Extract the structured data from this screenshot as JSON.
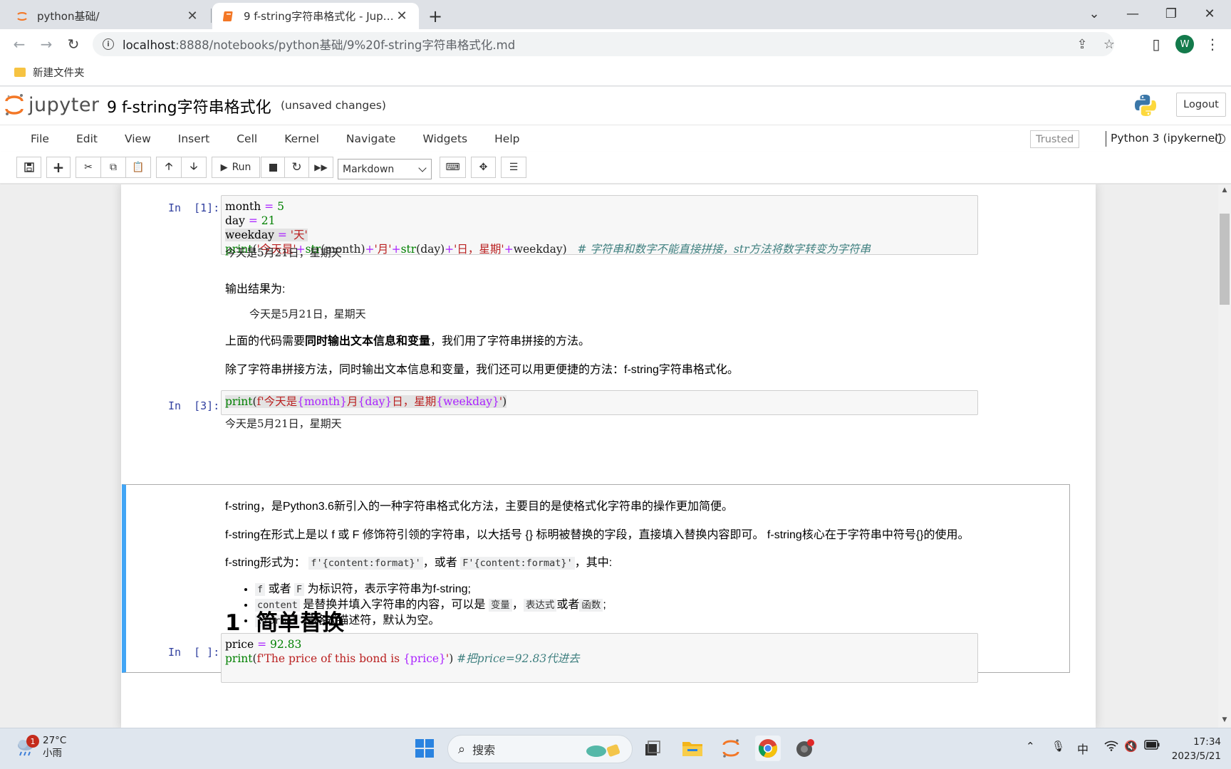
{
  "browser": {
    "tabs": [
      {
        "label": "python基础/",
        "active": false
      },
      {
        "label": "9 f-string字符串格式化 - Jupyter Notebook",
        "active": true
      }
    ],
    "url_host": "localhost",
    "url_rest": ":8888/notebooks/python基础/9%20f-string字符串格式化.md",
    "profile_initial": "W",
    "bookmark": "新建文件夹"
  },
  "jupyter": {
    "logo_text": "jupyter",
    "notebook_title": "9 f-string字符串格式化",
    "save_status": "(unsaved changes)",
    "logout": "Logout",
    "menus": [
      "File",
      "Edit",
      "View",
      "Insert",
      "Cell",
      "Kernel",
      "Navigate",
      "Widgets",
      "Help"
    ],
    "trusted": "Trusted",
    "kernel": "Python 3 (ipykernel)",
    "run_label": "Run",
    "cell_type": "Markdown"
  },
  "cells": {
    "c1": {
      "prompt": "In  [1]:",
      "line1_var": "month",
      "line1_op": " = ",
      "line1_val": "5",
      "line2_var": "day",
      "line2_op": " = ",
      "line2_val": "21",
      "line3_var": "weekday",
      "line3_op": " = ",
      "line3_val": "'天'",
      "line4_fn": "print",
      "line4_p1": "(",
      "line4_s1": "'今天是'",
      "line4_o1": "+",
      "line4_f1": "str",
      "line4_a1": "(month)",
      "line4_o2": "+",
      "line4_s2": "'月'",
      "line4_o3": "+",
      "line4_f2": "str",
      "line4_a2": "(day)",
      "line4_o4": "+",
      "line4_s3": "'日，星期'",
      "line4_o5": "+",
      "line4_a3": "weekday)",
      "line4_comment": "# 字符串和数字不能直接拼接，str方法将数字转变为字符串",
      "output": "今天是5月21日，星期天"
    },
    "md1": {
      "p1": "输出结果为:",
      "p2": "今天是5月21日，星期天",
      "p3_a": "上面的代码需要",
      "p3_b": "同时输出文本信息和变量",
      "p3_c": "，我们用了字符串拼接的方法。",
      "p4": "除了字符串拼接方法，同时输出文本信息和变量，我们还可以用更便捷的方法：f-string字符串格式化。"
    },
    "c3": {
      "prompt": "In  [3]:",
      "fn": "print",
      "p": "(",
      "s1": "f'今天是",
      "v1": "{month}",
      "s2": "月",
      "v2": "{day}",
      "s3": "日，星期",
      "v3": "{weekday}",
      "s4": "'",
      "p2": ")",
      "output": "今天是5月21日，星期天"
    },
    "md2": {
      "p1": "f-string，是Python3.6新引入的一种字符串格式化方法，主要目的是使格式化字符串的操作更加简便。",
      "p2": "f-string在形式上是以 f 或 F 修饰符引领的字符串，以大括号 {} 标明被替换的字段，直接填入替换内容即可。 f-string核心在于字符串中符号{}的使用。",
      "p3_a": "f-string形式为：",
      "p3_code1": "f'{content:format}'",
      "p3_b": "，或者",
      "p3_code2": "F'{content:format}'",
      "p3_c": "，其中:",
      "li1_code1": "f",
      "li1_a": " 或者 ",
      "li1_code2": "F",
      "li1_b": " 为标识符，表示字符串为f-string;",
      "li2_code1": "content",
      "li2_a": " 是替换并填入字符串的内容，可以是 ",
      "li2_code2": "变量",
      "li2_b": "，",
      "li2_code3": "表达式",
      "li2_c": "或者",
      "li2_code4": "函数",
      "li2_d": ";",
      "li3_code1": ":format",
      "li3_a": " 是格式描述符，默认为空。",
      "heading": "1  简单替换"
    },
    "c4": {
      "prompt": "In  [ ]:",
      "line1_var": "price",
      "line1_op": " = ",
      "line1_val": "92.83",
      "line2_fn": "print",
      "line2_p": "(",
      "line2_s1": "f'The price of this bond is ",
      "line2_v": "{price}",
      "line2_s2": "'",
      "line2_p2": ")",
      "line2_comment": "#把price=92.83代进去"
    }
  },
  "taskbar": {
    "temp": "27°C",
    "weather": "小雨",
    "notif_count": "1",
    "search": "搜索",
    "ime": "中",
    "time": "17:34",
    "date": "2023/5/21"
  },
  "colors": {
    "jupyter_orange": "#f37726",
    "selected_cell_border": "#42a5f5",
    "code_keyword": "#008000",
    "code_string": "#ba2121",
    "code_comment": "#408080"
  }
}
